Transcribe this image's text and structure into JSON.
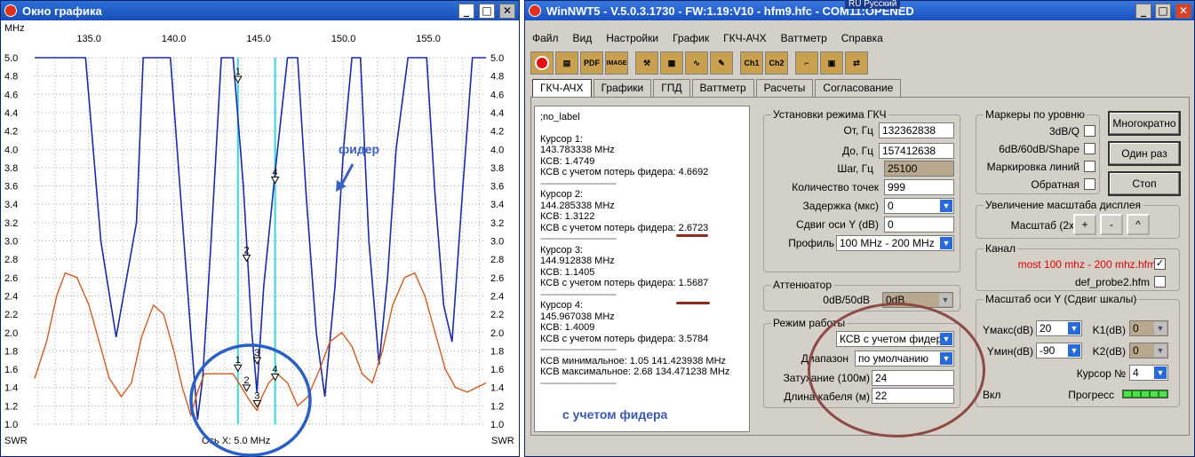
{
  "graph_window": {
    "title": "Окно графика",
    "mhz_label": "MHz",
    "swr_left": "SWR",
    "swr_right": "SWR",
    "axis_note": "Ось X: 5.0 MHz",
    "annotation": "фидер",
    "x_ticks": [
      "135.0",
      "140.0",
      "145.0",
      "150.0",
      "155.0"
    ],
    "y_ticks": [
      "5.0",
      "4.8",
      "4.6",
      "4.4",
      "4.2",
      "4.0",
      "3.8",
      "3.6",
      "3.4",
      "3.2",
      "3.0",
      "2.8",
      "2.6",
      "2.4",
      "2.2",
      "2.0",
      "1.8",
      "1.6",
      "1.4",
      "1.2",
      "1.0"
    ],
    "colors": {
      "blue": "#1c2aa8",
      "red": "#d25a20",
      "cursor": "#3ad8d8",
      "circle": "#2a5fc4"
    }
  },
  "chart_data": {
    "type": "line",
    "title": "",
    "xlabel": "",
    "ylabel": "SWR",
    "xlim": [
      131.8,
      158.4
    ],
    "ylim": [
      1.0,
      5.0
    ],
    "grid": true,
    "series": [
      {
        "color": "#1c2aa8",
        "x": [
          131.8,
          133.5,
          134.8,
          135.7,
          136.6,
          137.8,
          138.2,
          139.0,
          139.8,
          140.4,
          141.0,
          141.4,
          141.7,
          142.2,
          142.8,
          143.5,
          144.1,
          144.6,
          144.9,
          145.3,
          146.0,
          146.7,
          147.3,
          147.8,
          148.4,
          148.9,
          149.5,
          150.0,
          150.5,
          151.0,
          151.5,
          152.1,
          152.6,
          153.1,
          153.8,
          154.4,
          154.9,
          155.4,
          155.9,
          156.4,
          157.0,
          157.6,
          158.4
        ],
        "y": [
          5.0,
          5.0,
          5.0,
          3.0,
          1.95,
          3.2,
          5.0,
          5.0,
          5.0,
          3.5,
          2.0,
          1.05,
          1.5,
          3.0,
          5.0,
          5.0,
          3.6,
          2.0,
          1.35,
          2.5,
          3.8,
          5.0,
          5.0,
          3.5,
          2.0,
          1.3,
          2.5,
          4.0,
          5.0,
          5.0,
          3.0,
          1.65,
          2.6,
          4.0,
          5.0,
          5.0,
          5.0,
          3.5,
          2.3,
          1.9,
          3.5,
          5.0,
          5.0
        ]
      },
      {
        "color": "#d25a20",
        "x": [
          131.8,
          132.5,
          133.1,
          133.6,
          134.3,
          135.0,
          135.6,
          136.2,
          136.9,
          137.5,
          138.1,
          138.8,
          139.4,
          140.0,
          140.5,
          141.0,
          141.4,
          141.8,
          142.3,
          142.9,
          143.5,
          144.0,
          144.5,
          144.9,
          145.2,
          145.6,
          146.1,
          146.7,
          147.3,
          147.9,
          148.6,
          149.2,
          149.9,
          150.5,
          151.1,
          151.7,
          152.3,
          152.9,
          153.6,
          154.2,
          154.8,
          155.4,
          156.0,
          156.6,
          157.3,
          158.4
        ],
        "y": [
          1.5,
          1.9,
          2.4,
          2.65,
          2.6,
          2.3,
          1.9,
          1.5,
          1.3,
          1.45,
          1.95,
          2.3,
          2.2,
          1.8,
          1.4,
          1.1,
          1.35,
          1.55,
          1.55,
          1.55,
          1.55,
          1.4,
          1.25,
          1.15,
          1.3,
          1.45,
          1.55,
          1.45,
          1.2,
          1.3,
          1.6,
          1.9,
          2.0,
          1.85,
          1.55,
          1.45,
          1.8,
          2.3,
          2.6,
          2.65,
          2.4,
          2.0,
          1.6,
          1.4,
          1.35,
          1.45
        ]
      }
    ],
    "cursors": [
      {
        "label": "1",
        "x": 143.78,
        "y_blue": 4.7,
        "y_red": 1.55
      },
      {
        "label": "2",
        "x": 144.29,
        "y_blue": 2.75,
        "y_red": 1.33
      },
      {
        "label": "3",
        "x": 144.91,
        "y_blue": 1.63,
        "y_red": 1.16
      },
      {
        "label": "4",
        "x": 145.97,
        "y_blue": 3.6,
        "y_red": 1.45
      }
    ]
  },
  "main_window": {
    "title": "WinNWT5 - V.5.0.3.1730 - FW:1.19:V10 - hfm9.hfc - COM11:OPENED",
    "lang": "RU Русский",
    "menu": [
      "Файл",
      "Вид",
      "Настройки",
      "График",
      "ГКЧ-АЧХ",
      "Ваттметр",
      "Справка"
    ],
    "toolbar": [
      "power-icon",
      "print-icon",
      "PDF",
      "IMAGE",
      "tools-icon",
      "grid-icon",
      "wave-icon",
      "probe-icon",
      "Ch1",
      "Ch2",
      "step-icon",
      "save-icon",
      "swap-icon"
    ],
    "tabs": [
      "ГКЧ-АЧХ",
      "Графики",
      "ГПД",
      "Ваттметр",
      "Расчеты",
      "Согласование"
    ],
    "memo": {
      "header": ";no_label",
      "c1": [
        "Курсор 1:",
        "143.783338 MHz",
        "КСВ: 1.4749",
        "КСВ с учетом потерь фидера: 4.6692"
      ],
      "c2": [
        "Курсор 2:",
        "144.285338 MHz",
        "КСВ: 1.3122",
        "КСВ с учетом потерь фидера: 2.6723"
      ],
      "c3": [
        "Курсор 3:",
        "144.912838 MHz",
        "КСВ: 1.1405",
        "КСВ с учетом потерь фидера: 1.5687"
      ],
      "c4": [
        "Курсор 4:",
        "145.967038 MHz",
        "КСВ: 1.4009",
        "КСВ с учетом потерь фидера: 3.5784"
      ],
      "min": "КСВ минимальное: 1.05  141.423938 MHz",
      "max": "КСВ максимальное: 2.68  134.471238 MHz",
      "dash": "--------------------------------",
      "annotation": "с учетом фидера"
    },
    "gkch": {
      "title": "Установки режима ГКЧ",
      "from_label": "От, Гц",
      "from_value": "132362838",
      "to_label": "До, Гц",
      "to_value": "157412638",
      "step_label": "Шаг, Гц",
      "step_value": "25100",
      "points_label": "Количество точек",
      "points_value": "999",
      "delay_label": "Задержка (мкс)",
      "delay_value": "0",
      "shift_label": "Сдвиг оси Y (dB)",
      "shift_value": "0",
      "profile_label": "Профиль",
      "profile_value": "100 MHz - 200 MHz"
    },
    "atten": {
      "title": "Аттенюатор",
      "label": "0dB/50dB",
      "value": "0dB"
    },
    "mode": {
      "title": "Режим работы",
      "mode_value": "КСВ с учетом фидера",
      "range_label": "Диапазон",
      "range_value": "по умолчанию",
      "atten_label": "Затухание (100м)",
      "atten_value": "24",
      "cable_label": "Длина кабеля (м)",
      "cable_value": "22"
    },
    "markers": {
      "title": "Маркеры по уровню",
      "items": [
        "3dB/Q",
        "6dB/60dB/Shape",
        "Маркировка линий",
        "Обратная"
      ]
    },
    "buttons": {
      "multi": "Многократно",
      "once": "Один раз",
      "stop": "Стоп"
    },
    "zoom": {
      "title": "Увеличение масштаба дисплея",
      "label": "Масштаб (2x)",
      "plus": "+",
      "minus": "-",
      "caret": "^"
    },
    "channel": {
      "title": "Канал",
      "file1": "most 100 mhz - 200 mhz.hfm",
      "file2": "def_probe2.hfm"
    },
    "yscale": {
      "title": "Масштаб оси Y (Сдвиг шкалы)",
      "ymax_label": "Yмакс(dB)",
      "ymax_value": "20",
      "ymin_label": "Yмин(dB)",
      "ymin_value": "-90",
      "k1_label": "K1(dB)",
      "k1_value": "0",
      "k2_label": "K2(dB)",
      "k2_value": "0",
      "cursor_label": "Курсор №",
      "cursor_value": "4",
      "on_label": "Вкл",
      "progress_label": "Прогресс"
    }
  }
}
